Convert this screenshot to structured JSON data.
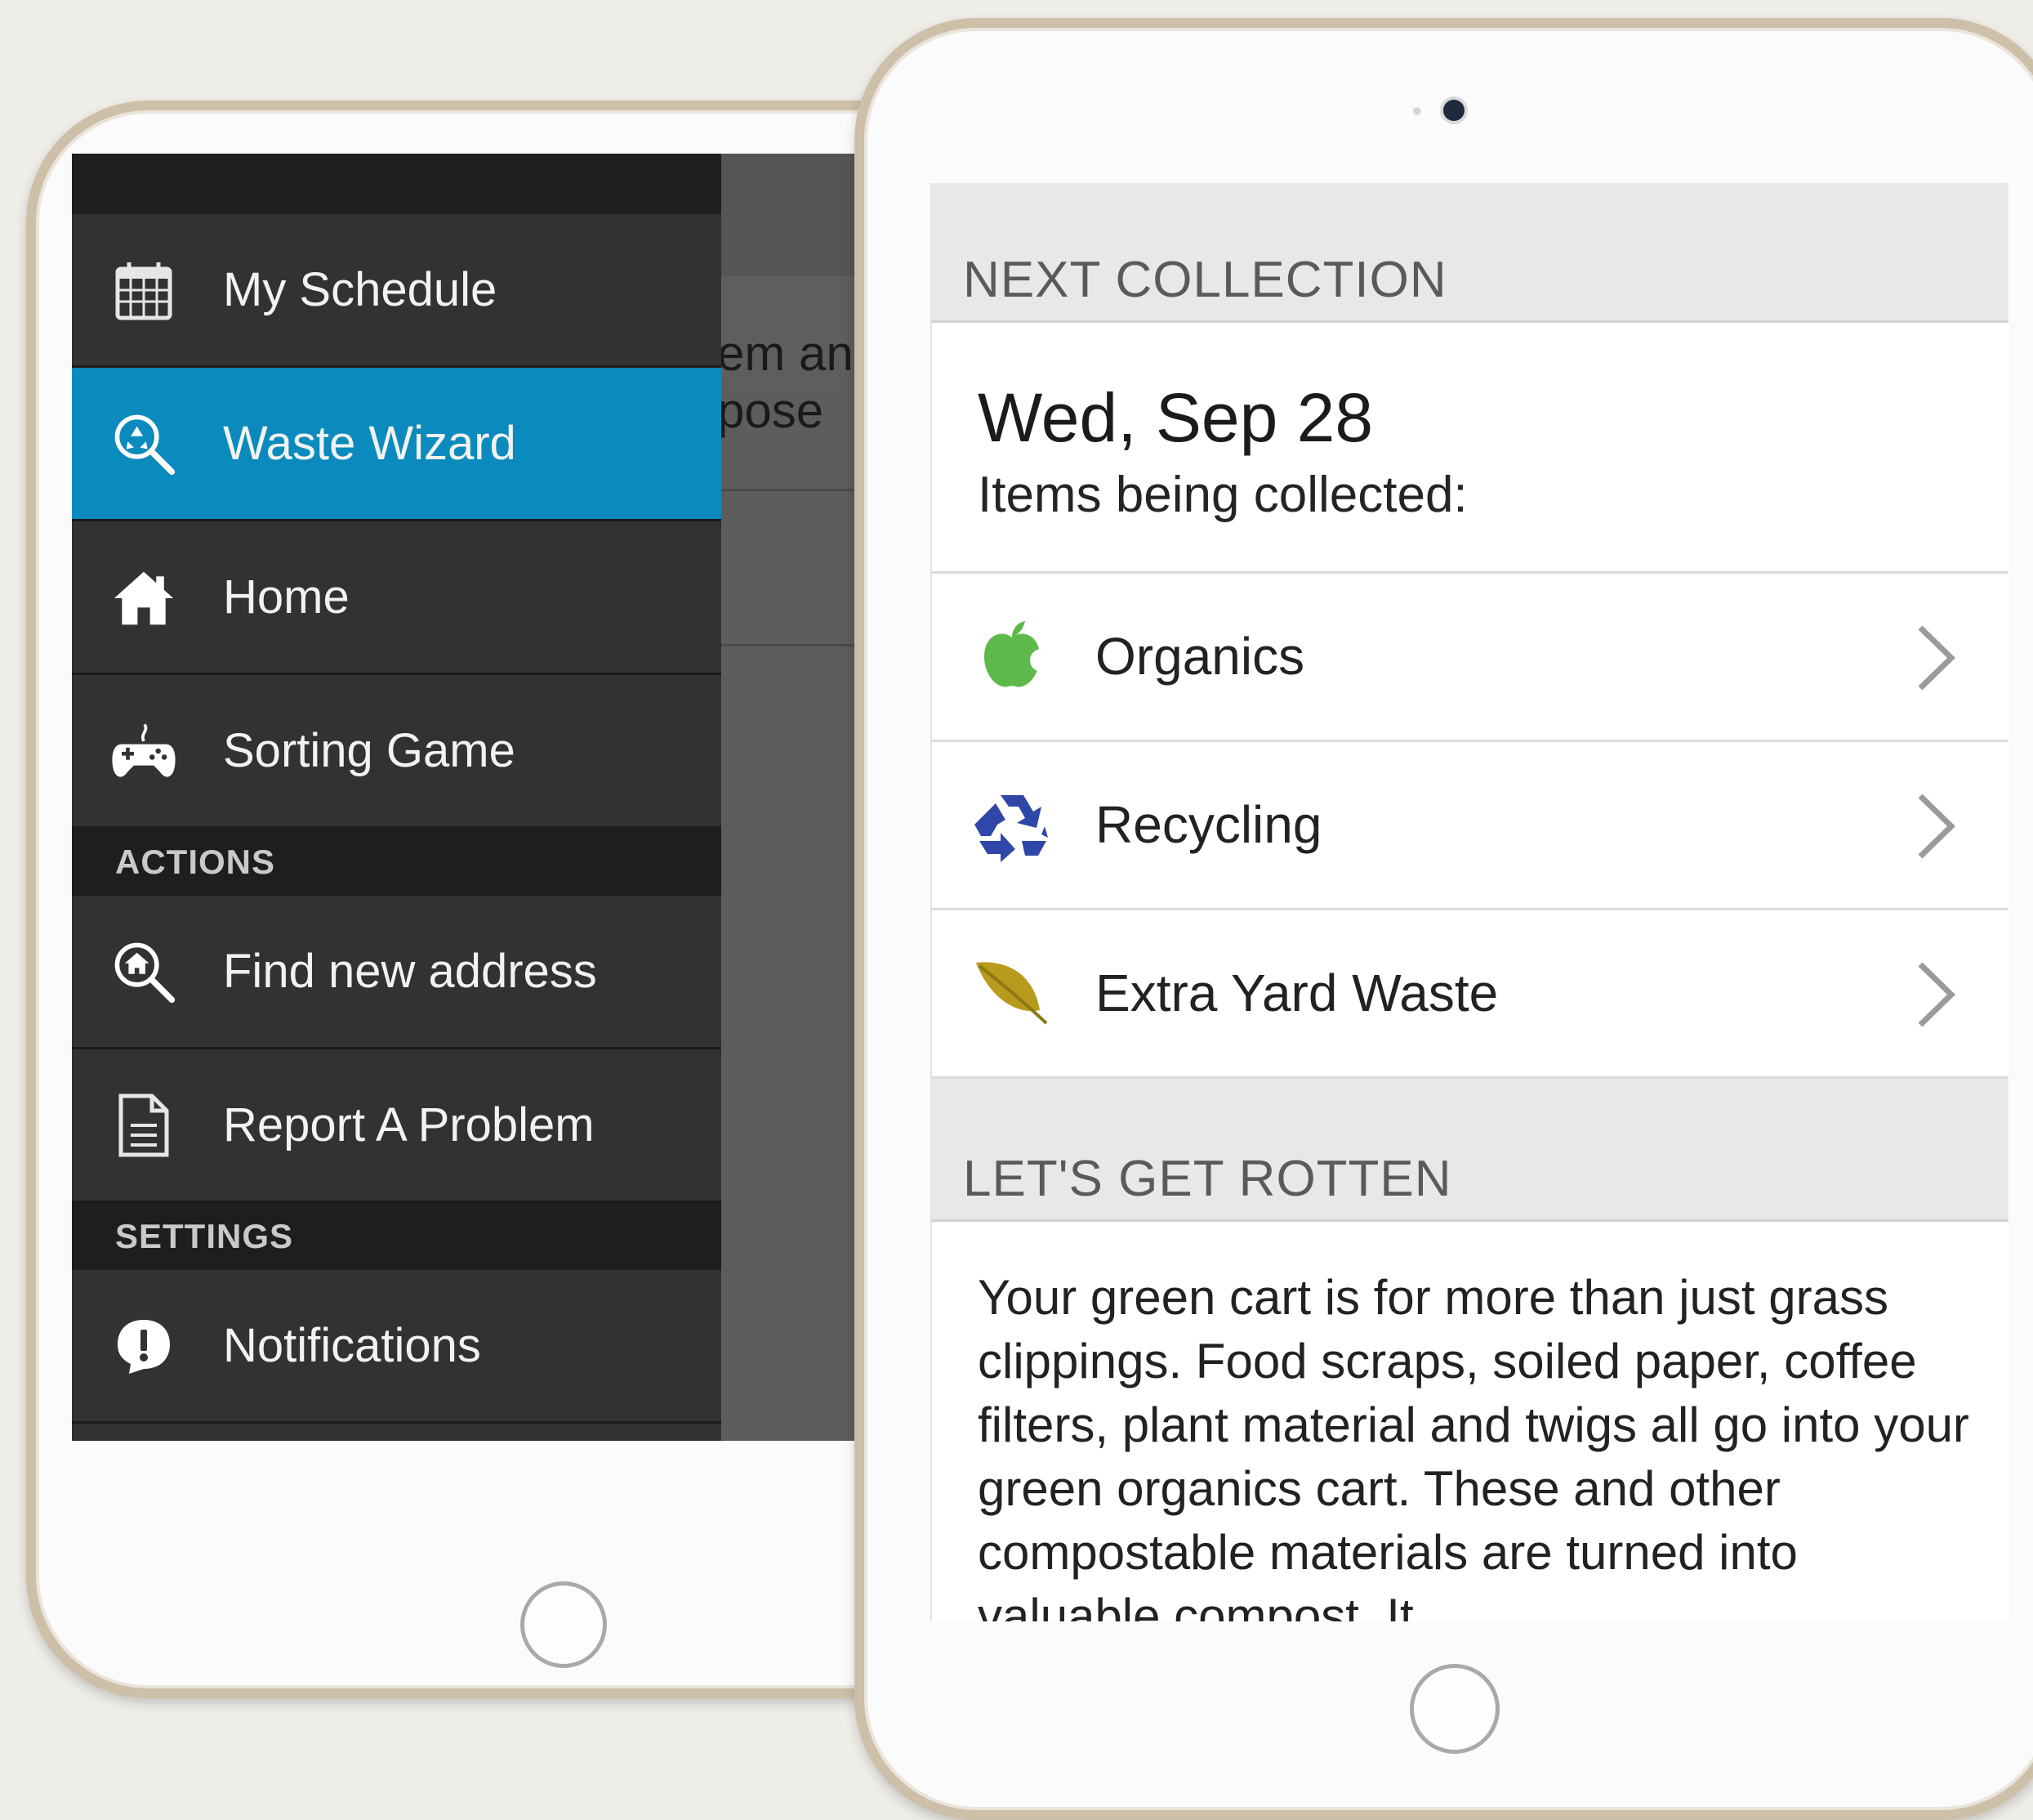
{
  "left_screen": {
    "background_snippets": [
      "em an",
      "pose"
    ],
    "drawer": {
      "items": [
        {
          "label": "My Schedule",
          "icon": "calendar-icon"
        },
        {
          "label": "Waste Wizard",
          "icon": "search-recycle-icon",
          "active": true
        },
        {
          "label": "Home",
          "icon": "home-icon"
        },
        {
          "label": "Sorting Game",
          "icon": "gamepad-icon"
        }
      ],
      "actions_header": "ACTIONS",
      "actions": [
        {
          "label": "Find new address",
          "icon": "search-home-icon"
        },
        {
          "label": "Report A Problem",
          "icon": "document-icon"
        }
      ],
      "settings_header": "SETTINGS",
      "settings": [
        {
          "label": "Notifications",
          "icon": "alert-bubble-icon"
        }
      ]
    }
  },
  "right_screen": {
    "next_collection_header": "NEXT COLLECTION",
    "date": "Wed, Sep 28",
    "items_being_collected": "Items being collected:",
    "collections": [
      {
        "label": "Organics",
        "icon": "apple-icon",
        "color": "#5dba4a"
      },
      {
        "label": "Recycling",
        "icon": "recycle-icon",
        "color": "#2f47a8"
      },
      {
        "label": "Extra Yard Waste",
        "icon": "leaf-icon",
        "color": "#b79b1c"
      }
    ],
    "tip_header": "LET'S GET ROTTEN",
    "tip_text": "Your green cart is for more than just grass clippings. Food scraps, soiled paper, coffee filters, plant material and twigs all go into your green organics cart. These and other compostable materials are turned into valuable compost. It"
  },
  "colors": {
    "drawer_bg": "#323232",
    "drawer_active": "#0b8bbd",
    "section_bg": "#1e1e1e",
    "header_bg": "#e8e8e8",
    "page_bg": "#efede7"
  }
}
